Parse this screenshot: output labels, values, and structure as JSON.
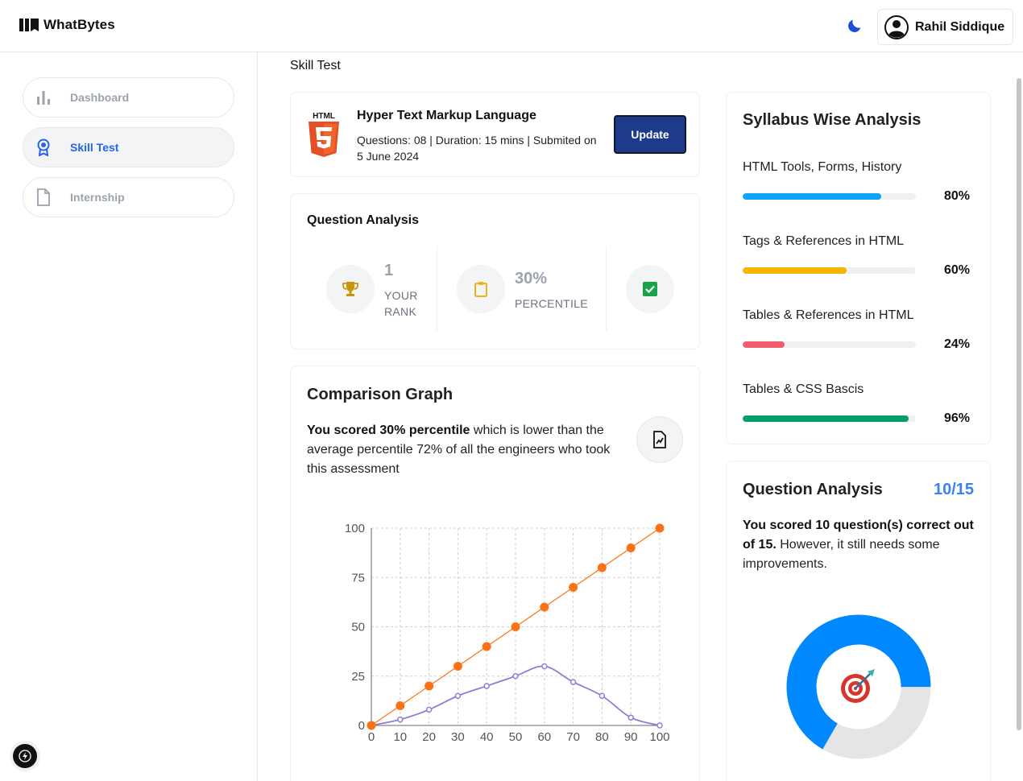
{
  "header": {
    "brand": "WhatBytes",
    "user_name": "Rahil Siddique"
  },
  "sidebar": {
    "items": [
      {
        "label": "Dashboard",
        "icon": "bar-chart-icon",
        "active": false
      },
      {
        "label": "Skill Test",
        "icon": "award-icon",
        "active": true
      },
      {
        "label": "Internship",
        "icon": "file-icon",
        "active": false
      }
    ]
  },
  "page_title": "Skill Test",
  "test_card": {
    "icon": "html5-icon",
    "title": "Hyper Text Markup Language",
    "meta": "Questions: 08 | Duration: 15 mins | Submited on 5 June 2024",
    "update_label": "Update"
  },
  "question_analysis": {
    "title": "Question Analysis",
    "stats": [
      {
        "value": "1",
        "label_line1": "YOUR",
        "label_line2": "RANK",
        "icon": "trophy-icon"
      },
      {
        "value": "30%",
        "label": "PERCENTILE",
        "icon": "clipboard-icon"
      },
      {
        "icon": "check-square-icon"
      }
    ]
  },
  "comparison": {
    "title": "Comparison Graph",
    "text_bold": "You scored 30% percentile",
    "text_rest": " which is lower than the average percentile 72% of all the engineers who took this assessment",
    "icon": "chart-file-icon"
  },
  "chart_data": {
    "type": "line",
    "x": [
      0,
      10,
      20,
      30,
      40,
      50,
      60,
      70,
      80,
      90,
      100
    ],
    "xticks": [
      "0",
      "10",
      "20",
      "30",
      "40",
      "50",
      "60",
      "70",
      "80",
      "90",
      "100"
    ],
    "yticks": [
      "0",
      "25",
      "50",
      "75",
      "100"
    ],
    "xlim": [
      0,
      100
    ],
    "ylim": [
      0,
      100
    ],
    "grid": true,
    "series": [
      {
        "color": "#f97316",
        "values": [
          0,
          10,
          20,
          30,
          40,
          50,
          60,
          70,
          80,
          90,
          100
        ]
      },
      {
        "color": "#8b80d8",
        "values": [
          0,
          3,
          8,
          15,
          20,
          25,
          30,
          22,
          15,
          4,
          0
        ]
      }
    ]
  },
  "syllabus": {
    "title": "Syllabus Wise Analysis",
    "items": [
      {
        "label": "HTML Tools, Forms, History",
        "percent": 80,
        "percent_text": "80%",
        "color": "#0ea5f9"
      },
      {
        "label": "Tags & References in HTML",
        "percent": 60,
        "percent_text": "60%",
        "color": "#f7b500"
      },
      {
        "label": "Tables & References in HTML",
        "percent": 24,
        "percent_text": "24%",
        "color": "#f25c6b"
      },
      {
        "label": "Tables & CSS Bascis",
        "percent": 96,
        "percent_text": "96%",
        "color": "#079e6a"
      }
    ]
  },
  "question_analysis_2": {
    "title": "Question Analysis",
    "score": "10/15",
    "text_bold": "You scored 10 question(s) correct out of 15.",
    "text_rest": " However, it still needs some improvements.",
    "correct": 10,
    "total": 15,
    "colors": {
      "correct": "#0088ff",
      "remaining": "#e5e5e5"
    },
    "center_icon": "target-icon"
  }
}
